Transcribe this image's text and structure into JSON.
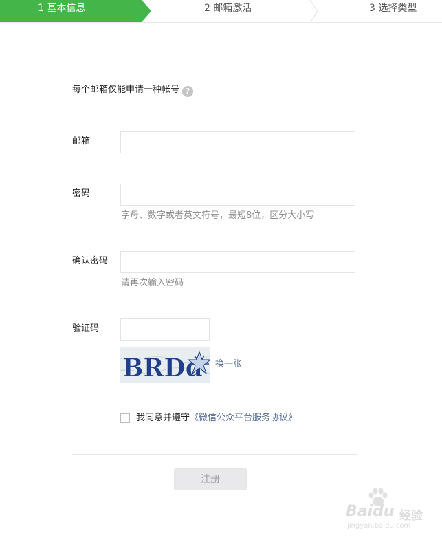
{
  "steps": [
    {
      "label": "1 基本信息",
      "active": true
    },
    {
      "label": "2 邮箱激活",
      "active": false
    },
    {
      "label": "3 选择类型",
      "active": false
    }
  ],
  "form": {
    "notice": "每个邮箱仅能申请一种帐号",
    "help_icon": "question-circle-icon",
    "email_label": "邮箱",
    "email_value": "",
    "password_label": "密码",
    "password_value": "",
    "password_hint": "字母、数字或者英文符号，最短8位，区分大小写",
    "confirm_label": "确认密码",
    "confirm_value": "",
    "confirm_hint": "请再次输入密码",
    "captcha_label": "验证码",
    "captcha_value": "",
    "captcha_text": "BRDd",
    "refresh_label": "换一张",
    "agree_prefix": "我同意并遵守",
    "agree_link": "《微信公众平台服务协议》",
    "agree_checked": false,
    "submit_label": "注册"
  },
  "watermark": {
    "brand": "Baidu",
    "brand_suffix": "经验",
    "url": "jingyan.baidu.com"
  },
  "colors": {
    "accent_green": "#44b549",
    "link_blue": "#576b95",
    "hint_gray": "#8d8d8d",
    "border": "#e4e4e4"
  }
}
